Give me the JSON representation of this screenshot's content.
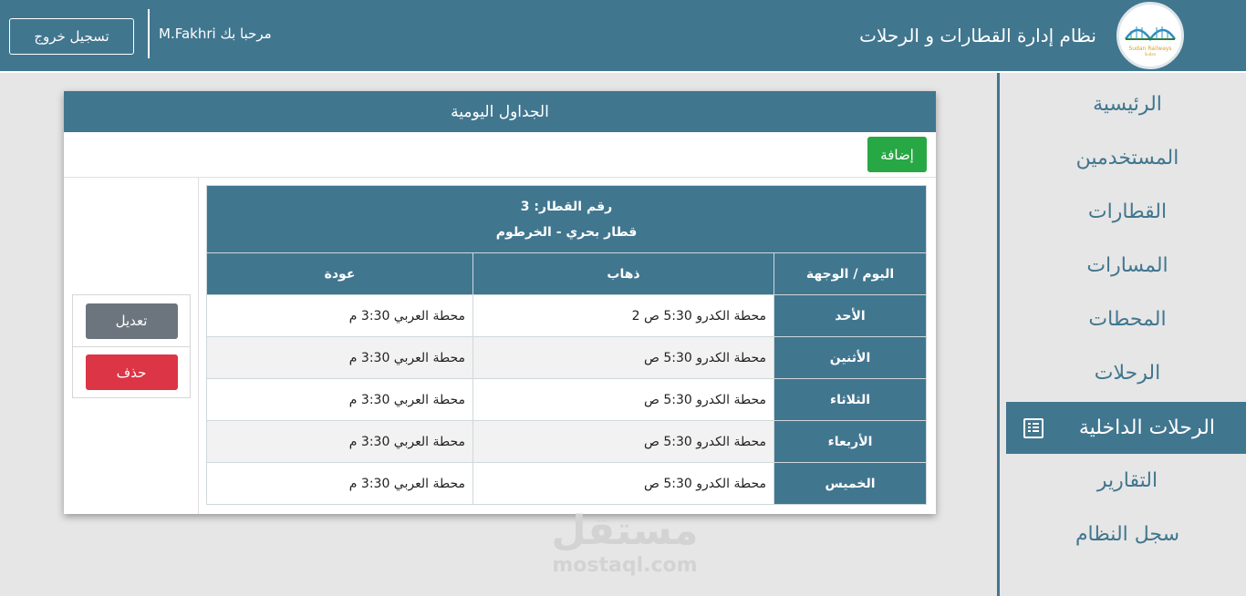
{
  "header": {
    "app_title": "نظام إدارة القطارات و الرحلات",
    "welcome": "مرحبا بك M.Fakhri",
    "logout_label": "تسجيل خروج",
    "logo_text": "Sudan Railways",
    "logo_subtext": "Sudan"
  },
  "sidebar": {
    "items": [
      {
        "label": "الرئيسية"
      },
      {
        "label": "المستخدمين"
      },
      {
        "label": "القطارات"
      },
      {
        "label": "المسارات"
      },
      {
        "label": "المحطات"
      },
      {
        "label": "الرحلات"
      },
      {
        "label": "الرحلات الداخلية",
        "active": true,
        "icon": "list-icon"
      },
      {
        "label": "التقارير"
      },
      {
        "label": "سجل النظام"
      }
    ]
  },
  "panel": {
    "title": "الجداول اليومية",
    "add_label": "إضافة",
    "edit_label": "تعديل",
    "delete_label": "حذف"
  },
  "schedule": {
    "train_number": "رقم القطار: 3",
    "train_name": "قطار بحري - الخرطوم",
    "columns": [
      "اليوم / الوجهة",
      "ذهاب",
      "عودة"
    ],
    "rows": [
      {
        "day": "الأحد",
        "go": "محطة الكدرو 5:30 ص 2",
        "return": "محطة العربي 3:30 م"
      },
      {
        "day": "الأثنين",
        "go": "محطة الكدرو 5:30 ص",
        "return": "محطة العربي 3:30 م"
      },
      {
        "day": "الثلاثاء",
        "go": "محطة الكدرو 5:30 ص",
        "return": "محطة العربي 3:30 م"
      },
      {
        "day": "الأربعاء",
        "go": "محطة الكدرو 5:30 ص",
        "return": "محطة العربي 3:30 م"
      },
      {
        "day": "الخميس",
        "go": "محطة الكدرو 5:30 ص",
        "return": "محطة العربي 3:30 م"
      }
    ]
  },
  "watermark": {
    "arabic": "مستقل",
    "latin": "mostaql.com"
  },
  "colors": {
    "primary": "#41768f",
    "success": "#28a745",
    "danger": "#dc3545",
    "secondary": "#6c757d",
    "background": "#e6e6e6"
  }
}
